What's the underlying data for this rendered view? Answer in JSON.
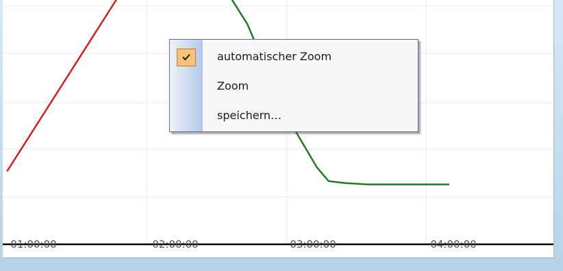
{
  "chart_data": {
    "type": "line",
    "x_tick_labels": [
      "01:00:00",
      "02:00:00",
      "03:00:00",
      "04:00:00"
    ],
    "grid": true,
    "series": [
      {
        "color": "#cc2020",
        "points": [
          [
            "00:59:30",
            0.1
          ],
          [
            "01:48:00",
            1.0
          ]
        ]
      },
      {
        "color": "#1f7a22",
        "points": [
          [
            "02:35:00",
            1.0
          ],
          [
            "02:43:00",
            0.85
          ],
          [
            "02:52:00",
            0.6
          ],
          [
            "03:00:00",
            0.38
          ],
          [
            "03:08:00",
            0.22
          ],
          [
            "03:13:00",
            0.12
          ],
          [
            "03:18:00",
            0.05
          ],
          [
            "03:25:00",
            0.04
          ],
          [
            "03:35:00",
            0.033
          ],
          [
            "04:10:00",
            0.033
          ]
        ]
      }
    ],
    "colors": {
      "axis": "#000000",
      "grid": "#d4d4d4",
      "background": "#ffffff"
    }
  },
  "context_menu": {
    "items": [
      {
        "label": "automatischer Zoom",
        "checked": true,
        "icon": "checkmark-icon"
      },
      {
        "label": "Zoom",
        "checked": false
      },
      {
        "label": "speichern…",
        "checked": false
      }
    ],
    "colors": {
      "check_background": "#f9c27a",
      "border": "#5b6e8e"
    }
  }
}
